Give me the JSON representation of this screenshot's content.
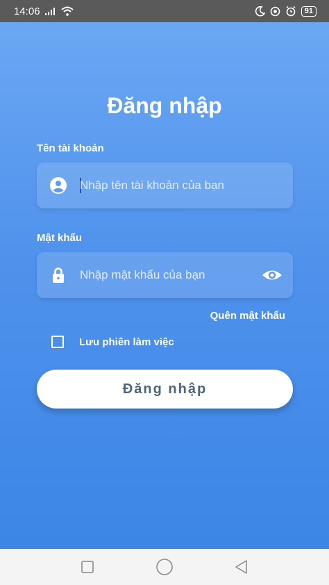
{
  "status_bar": {
    "time": "14:06",
    "battery": "91",
    "icons": [
      "signal-icon",
      "wifi-icon",
      "moon-icon",
      "location-icon",
      "alarm-icon",
      "battery-icon"
    ]
  },
  "login": {
    "title": "Đăng nhập",
    "username": {
      "label": "Tên tài khoản",
      "placeholder": "Nhập tên tài khoản của bạn",
      "value": "",
      "icon": "user-icon"
    },
    "password": {
      "label": "Mật khẩu",
      "placeholder": "Nhập mật khẩu của bạn",
      "value": "",
      "icon": "lock-icon",
      "toggle_icon": "eye-icon"
    },
    "forgot_password": "Quên mật khẩu",
    "remember_session": {
      "label": "Lưu phiên làm việc",
      "checked": false
    },
    "submit_label": "Đăng nhập"
  },
  "navigation": {
    "buttons": [
      "recent-apps-icon",
      "home-icon",
      "back-icon"
    ]
  },
  "colors": {
    "gradient_top": "#6ba7f3",
    "gradient_bottom": "#3c86e6",
    "button_text": "#4e6477",
    "status_bar": "#5a5a5a"
  }
}
